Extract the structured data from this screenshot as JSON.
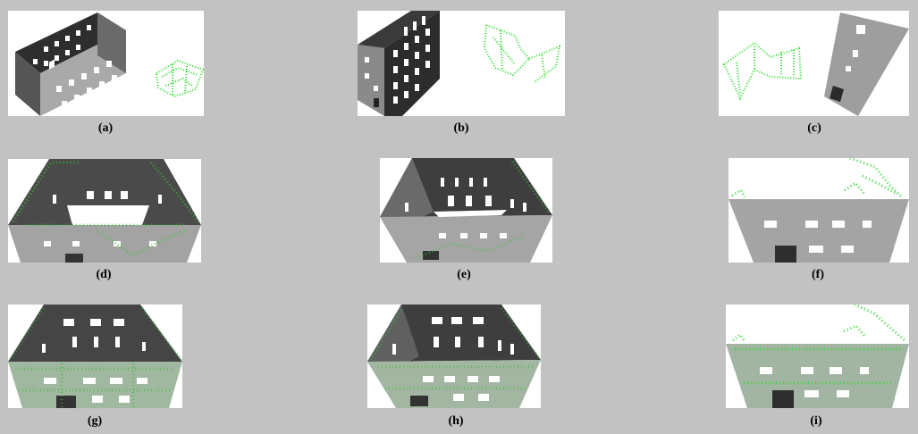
{
  "figure": {
    "captions": [
      "(a)",
      "(b)",
      "(c)",
      "(d)",
      "(e)",
      "(f)",
      "(g)",
      "(h)",
      "(i)"
    ]
  },
  "colors": {
    "background": "#c2c2c2",
    "panel": "#ffffff",
    "dark_wall": "#4a4a4a",
    "light_wall": "#9a9a9a",
    "point_cloud": "#33dd33"
  }
}
